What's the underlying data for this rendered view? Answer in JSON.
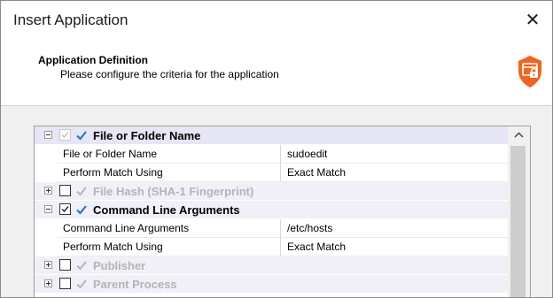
{
  "window": {
    "title": "Insert Application",
    "close_glyph": "✕"
  },
  "header": {
    "title": "Application Definition",
    "subtitle": "Please configure the criteria for the application",
    "icon": "application-lock-icon",
    "icon_color": "#f0641e"
  },
  "criteria": {
    "categories": [
      {
        "label": "File or Folder Name",
        "expanded": true,
        "checked": true,
        "enabled": true,
        "properties": [
          {
            "name": "File or Folder Name",
            "value": "sudoedit"
          },
          {
            "name": "Perform Match Using",
            "value": "Exact Match"
          }
        ]
      },
      {
        "label": "File Hash (SHA-1 Fingerprint)",
        "expanded": false,
        "checked": false,
        "enabled": false,
        "properties": []
      },
      {
        "label": "Command Line Arguments",
        "expanded": true,
        "checked": true,
        "enabled": true,
        "properties": [
          {
            "name": "Command Line Arguments",
            "value": "/etc/hosts"
          },
          {
            "name": "Perform Match Using",
            "value": "Exact Match"
          }
        ]
      },
      {
        "label": "Publisher",
        "expanded": false,
        "checked": false,
        "enabled": false,
        "properties": []
      },
      {
        "label": "Parent Process",
        "expanded": false,
        "checked": false,
        "enabled": false,
        "properties": []
      }
    ]
  },
  "colors": {
    "accent": "#f0641e",
    "check_blue": "#1e6ed2",
    "disabled_text": "#b4b4b4"
  }
}
